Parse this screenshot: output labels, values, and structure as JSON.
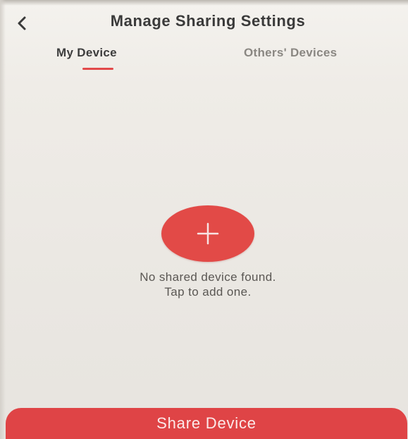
{
  "header": {
    "title": "Manage Sharing Settings",
    "back_icon": "chevron-left-icon"
  },
  "tabs": [
    {
      "label": "My Device",
      "active": true
    },
    {
      "label": "Others' Devices",
      "active": false
    }
  ],
  "empty_state": {
    "add_icon": "plus-icon",
    "line1": "No shared device found.",
    "line2": "Tap to add one."
  },
  "footer": {
    "share_label": "Share Device"
  },
  "colors": {
    "accent": "#e24a47",
    "background": "#efece7",
    "title_text": "#3a3a3a",
    "inactive_tab": "#8a8782"
  }
}
